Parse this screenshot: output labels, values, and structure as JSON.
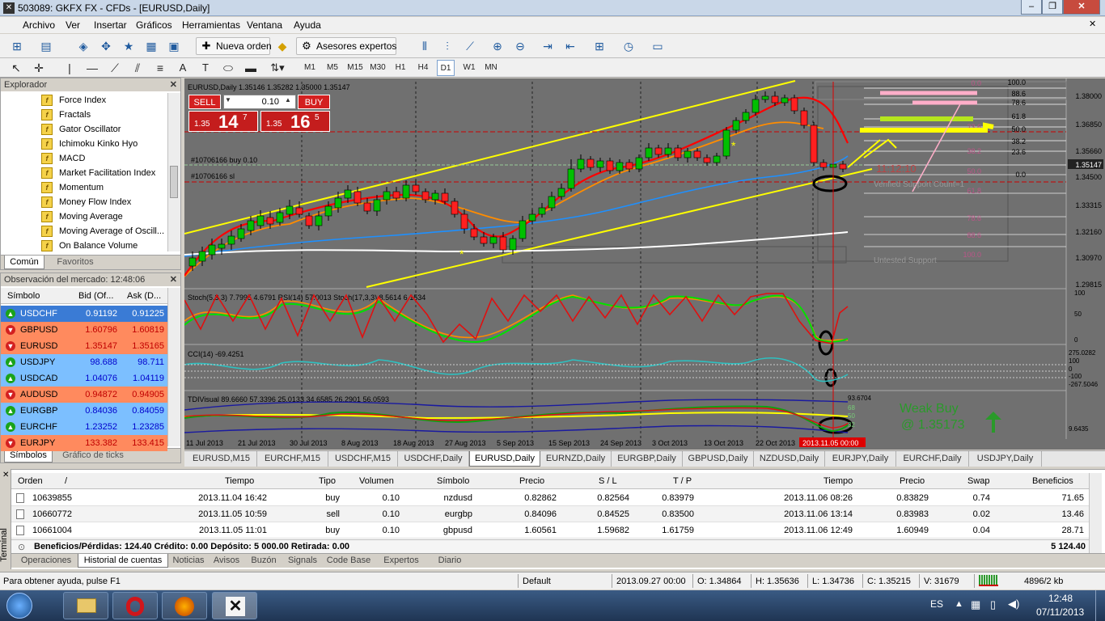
{
  "window": {
    "title": "503089: GKFX FX - CFDs - [EURUSD,Daily]",
    "app_icon": "mt4-icon",
    "min": "–",
    "max": "❐",
    "close": "✕"
  },
  "menu": [
    "Archivo",
    "Ver",
    "Insertar",
    "Gráficos",
    "Herramientas",
    "Ventana",
    "Ayuda"
  ],
  "toolbar": {
    "new_order": "Nueva orden",
    "expert_advisors": "Asesores expertos"
  },
  "timeframes": [
    "M1",
    "M5",
    "M15",
    "M30",
    "H1",
    "H4",
    "D1",
    "W1",
    "MN"
  ],
  "timeframe_selected": "D1",
  "explorer": {
    "title": "Explorador",
    "close": "✕",
    "items": [
      "Force Index",
      "Fractals",
      "Gator Oscillator",
      "Ichimoku Kinko Hyo",
      "MACD",
      "Market Facilitation Index",
      "Momentum",
      "Money Flow Index",
      "Moving Average",
      "Moving Average of Oscill...",
      "On Balance Volume"
    ],
    "tabs": [
      "Común",
      "Favoritos"
    ]
  },
  "market_watch": {
    "title": "Observación del mercado: 12:48:06",
    "close": "✕",
    "headers": [
      "Símbolo",
      "Bid (Of...",
      "Ask (D..."
    ],
    "rows": [
      {
        "symbol": "USDCHF",
        "bid": "0.91192",
        "ask": "0.91225",
        "dir": "up",
        "selected": true
      },
      {
        "symbol": "GBPUSD",
        "bid": "1.60796",
        "ask": "1.60819",
        "dir": "down"
      },
      {
        "symbol": "EURUSD",
        "bid": "1.35147",
        "ask": "1.35165",
        "dir": "down"
      },
      {
        "symbol": "USDJPY",
        "bid": "98.688",
        "ask": "98.711",
        "dir": "up"
      },
      {
        "symbol": "USDCAD",
        "bid": "1.04076",
        "ask": "1.04119",
        "dir": "up"
      },
      {
        "symbol": "AUDUSD",
        "bid": "0.94872",
        "ask": "0.94905",
        "dir": "down"
      },
      {
        "symbol": "EURGBP",
        "bid": "0.84036",
        "ask": "0.84059",
        "dir": "up"
      },
      {
        "symbol": "EURCHF",
        "bid": "1.23252",
        "ask": "1.23285",
        "dir": "up"
      },
      {
        "symbol": "EURJPY",
        "bid": "133.382",
        "ask": "133.415",
        "dir": "down"
      }
    ],
    "tabs": [
      "Símbolos",
      "Gráfico de ticks"
    ]
  },
  "chart": {
    "header": "EURUSD,Daily  1.35146 1.35282 1.35000 1.35147",
    "sell_label": "SELL",
    "buy_label": "BUY",
    "lots": "0.10",
    "sell_price": {
      "small": "1.35",
      "big": "14",
      "sup": "7"
    },
    "buy_price": {
      "small": "1.35",
      "big": "16",
      "sup": "5"
    },
    "order_line_1": "#10706166 buy 0.10",
    "order_line_2": "#10706166 sl",
    "price_labels": [
      "1.38000",
      "1.36850",
      "1.35660",
      "1.35147",
      "1.34500",
      "1.33315",
      "1.32160",
      "1.30970",
      "1.29815"
    ],
    "fib_labels": [
      "100.0",
      "88.6",
      "78.6",
      "61.8",
      "50.0",
      "38.2",
      "23.6",
      "0.0"
    ],
    "fib_labels_lower": [
      "0.0",
      "23.6",
      "38.2",
      "50.0",
      "61.8",
      "78.6",
      "88.6",
      "100.0"
    ],
    "timer": "11:12:10",
    "verified_support": "Verified Support Count=1",
    "untested_support": "Untested Support",
    "stoch_label": "Stoch(5,3,3) 7.7995 4.6791  RSI(14) 57.0013  Stoch(17,3,3) 8.5614 6.1534",
    "stoch_levels": [
      "100",
      "50",
      "0"
    ],
    "cci_label": "CCI(14) -69.4251",
    "cci_levels": [
      "275.0282",
      "100",
      "0",
      "-100",
      "-267.5046"
    ],
    "tdi_label": "TDIVisual 89.6660 57.3396 25.0133 34.6585 26.2901 56.0593",
    "tdi_levels": [
      "93.6704",
      "68",
      "50",
      "32",
      "9.6435"
    ],
    "weak_buy": "Weak Buy",
    "weak_buy_price": "@ 1.35173",
    "date_labels": [
      "11 Jul 2013",
      "21 Jul 2013",
      "30 Jul 2013",
      "8 Aug 2013",
      "18 Aug 2013",
      "27 Aug 2013",
      "5 Sep 2013",
      "15 Sep 2013",
      "24 Sep 2013",
      "3 Oct 2013",
      "13 Oct 2013",
      "22 Oct 2013"
    ],
    "date_cursor": "2013.11.05 00:00",
    "current_price": "1.35147",
    "colors": {
      "bg": "#707070",
      "bull": "#00c000",
      "bear": "#ff2020",
      "channel": "#ffff00",
      "ma_red": "#ff0000",
      "ma_orange": "#ff8c00",
      "ma_blue": "#1e90ff",
      "ma_white": "#ffffff"
    }
  },
  "chart_tabs": [
    "EURUSD,M15",
    "EURCHF,M15",
    "USDCHF,M15",
    "USDCHF,Daily",
    "EURUSD,Daily",
    "EURNZD,Daily",
    "EURGBP,Daily",
    "GBPUSD,Daily",
    "NZDUSD,Daily",
    "EURJPY,Daily",
    "EURCHF,Daily",
    "USDJPY,Daily"
  ],
  "chart_tab_selected": "EURUSD,Daily",
  "terminal": {
    "side_label": "Terminal",
    "headers": [
      "Orden",
      "/",
      "Tiempo",
      "Tipo",
      "Volumen",
      "Símbolo",
      "Precio",
      "S / L",
      "T / P",
      "Tiempo",
      "Precio",
      "Swap",
      "Beneficios"
    ],
    "rows": [
      {
        "order": "10639855",
        "time": "2013.11.04 16:42",
        "type": "buy",
        "volume": "0.10",
        "symbol": "nzdusd",
        "price": "0.82862",
        "sl": "0.82564",
        "tp": "0.83979",
        "close_time": "2013.11.06 08:26",
        "close_price": "0.83829",
        "swap": "0.74",
        "profit": "71.65"
      },
      {
        "order": "10660772",
        "time": "2013.11.05 10:59",
        "type": "sell",
        "volume": "0.10",
        "symbol": "eurgbp",
        "price": "0.84096",
        "sl": "0.84525",
        "tp": "0.83500",
        "close_time": "2013.11.06 13:14",
        "close_price": "0.83983",
        "swap": "0.02",
        "profit": "13.46"
      },
      {
        "order": "10661004",
        "time": "2013.11.05 11:01",
        "type": "buy",
        "volume": "0.10",
        "symbol": "gbpusd",
        "price": "1.60561",
        "sl": "1.59682",
        "tp": "1.61759",
        "close_time": "2013.11.06 12:49",
        "close_price": "1.60949",
        "swap": "0.04",
        "profit": "28.71"
      }
    ],
    "summary": "Beneficios/Pérdidas: 124.40  Crédito: 0.00  Depósito: 5 000.00  Retirada: 0.00",
    "summary_total": "5 124.40",
    "tabs": [
      "Operaciones",
      "Historial de cuentas",
      "Noticias",
      "Avisos",
      "Buzón",
      "Signals",
      "Code Base",
      "Expertos",
      "Diario"
    ],
    "tab_selected": "Historial de cuentas"
  },
  "status": {
    "help": "Para obtener ayuda, pulse F1",
    "profile": "Default",
    "datetime": "2013.09.27 00:00",
    "open": "O: 1.34864",
    "high": "H: 1.35636",
    "low": "L: 1.34736",
    "close": "C: 1.35215",
    "volume": "V: 31679",
    "traffic": "4896/2 kb"
  },
  "taskbar": {
    "lang": "ES",
    "time": "12:48",
    "date": "07/11/2013"
  }
}
